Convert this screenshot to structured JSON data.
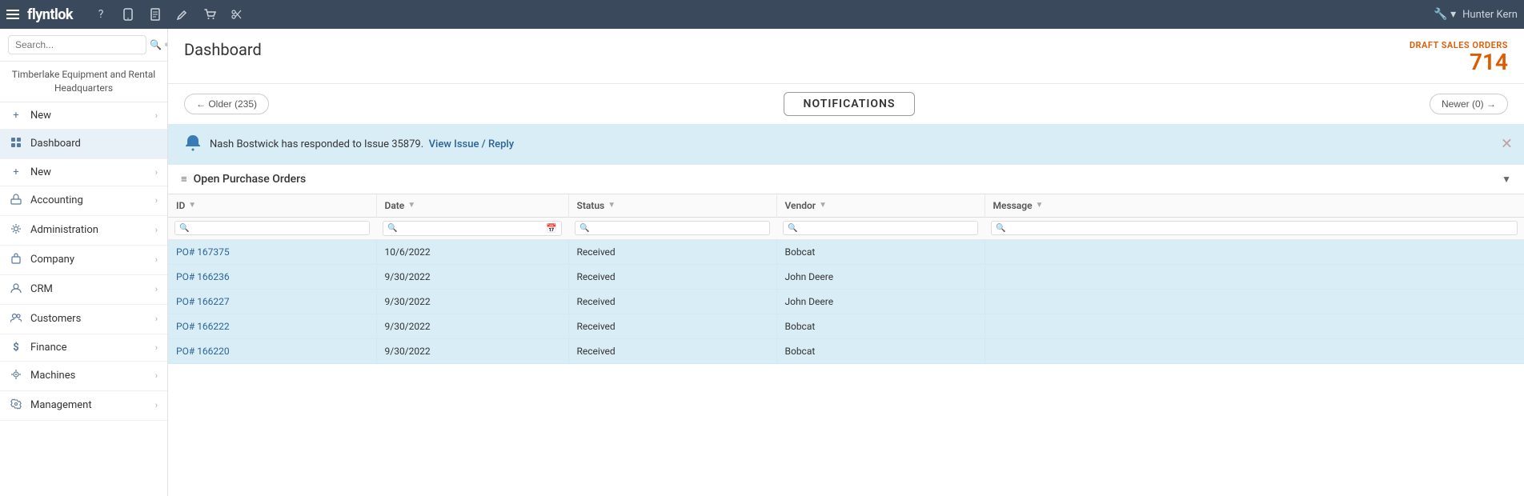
{
  "topnav": {
    "logo_text": "flyntlok",
    "icons": [
      "?",
      "📱",
      "📄",
      "✏️",
      "🛒",
      "✂️"
    ],
    "wrench_label": "🔧",
    "user_label": "Hunter Kern"
  },
  "sidebar": {
    "search_placeholder": "Search...",
    "company_name": "Timberlake Equipment and Rental Headquarters",
    "items": [
      {
        "id": "new-top",
        "label": "New",
        "icon": "+",
        "has_arrow": true
      },
      {
        "id": "dashboard",
        "label": "Dashboard",
        "icon": "⊞",
        "has_arrow": false
      },
      {
        "id": "new",
        "label": "New",
        "icon": "+",
        "has_arrow": true
      },
      {
        "id": "accounting",
        "label": "Accounting",
        "icon": "🏛",
        "has_arrow": true
      },
      {
        "id": "administration",
        "label": "Administration",
        "icon": "⚙",
        "has_arrow": true
      },
      {
        "id": "company",
        "label": "Company",
        "icon": "🏢",
        "has_arrow": true
      },
      {
        "id": "crm",
        "label": "CRM",
        "icon": "👤",
        "has_arrow": true
      },
      {
        "id": "customers",
        "label": "Customers",
        "icon": "👥",
        "has_arrow": true
      },
      {
        "id": "finance",
        "label": "Finance",
        "icon": "$",
        "has_arrow": true
      },
      {
        "id": "machines",
        "label": "Machines",
        "icon": "⚙",
        "has_arrow": true
      },
      {
        "id": "management",
        "label": "Management",
        "icon": "🔧",
        "has_arrow": true
      }
    ]
  },
  "main": {
    "title": "Dashboard",
    "draft_orders_label": "DRAFT SALES ORDERS",
    "draft_orders_count": "714"
  },
  "notifications": {
    "older_btn": "← Older (235)",
    "newer_btn": "Newer (0) →",
    "title": "NOTIFICATIONS",
    "banner_text": "Nash Bostwick has responded to Issue 35879.",
    "banner_link": "View Issue / Reply",
    "banner_link_separator": " / "
  },
  "purchase_orders": {
    "section_title": "Open Purchase Orders",
    "columns": [
      {
        "id": "id",
        "label": "ID"
      },
      {
        "id": "date",
        "label": "Date"
      },
      {
        "id": "status",
        "label": "Status"
      },
      {
        "id": "vendor",
        "label": "Vendor"
      },
      {
        "id": "message",
        "label": "Message"
      }
    ],
    "rows": [
      {
        "id": "PO# 167375",
        "date": "10/6/2022",
        "status": "Received",
        "vendor": "Bobcat",
        "message": ""
      },
      {
        "id": "PO# 166236",
        "date": "9/30/2022",
        "status": "Received",
        "vendor": "John Deere",
        "message": ""
      },
      {
        "id": "PO# 166227",
        "date": "9/30/2022",
        "status": "Received",
        "vendor": "John Deere",
        "message": ""
      },
      {
        "id": "PO# 166222",
        "date": "9/30/2022",
        "status": "Received",
        "vendor": "Bobcat",
        "message": ""
      },
      {
        "id": "PO# 166220",
        "date": "9/30/2022",
        "status": "Received",
        "vendor": "Bobcat",
        "message": ""
      }
    ]
  }
}
